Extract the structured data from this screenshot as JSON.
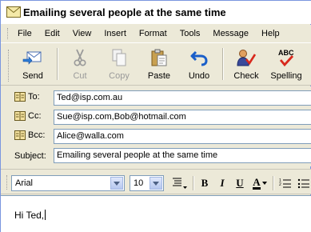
{
  "window": {
    "title": "Emailing several people at the same time"
  },
  "menu": {
    "items": [
      "File",
      "Edit",
      "View",
      "Insert",
      "Format",
      "Tools",
      "Message",
      "Help"
    ]
  },
  "toolbar": {
    "send_label": "Send",
    "cut_label": "Cut",
    "copy_label": "Copy",
    "paste_label": "Paste",
    "undo_label": "Undo",
    "check_label": "Check",
    "spelling_label": "Spelling",
    "spelling_icon_text": "ABC"
  },
  "headers": {
    "to": {
      "label": "To:",
      "value": "Ted@isp.com.au"
    },
    "cc": {
      "label": "Cc:",
      "value": "Sue@isp.com,Bob@hotmail.com"
    },
    "bcc": {
      "label": "Bcc:",
      "value": "Alice@walla.com"
    },
    "subject": {
      "label": "Subject:",
      "value": "Emailing several people at the same time"
    }
  },
  "format": {
    "font": "Arial",
    "size": "10",
    "bold": "B",
    "italic": "I",
    "underline": "U",
    "font_color": "A"
  },
  "body": {
    "text": "Hi Ted,"
  },
  "colors": {
    "window_bg": "#ece9d8",
    "field_border": "#7f9db9",
    "undo_blue": "#1a5fc9",
    "check_red": "#d8281c"
  }
}
